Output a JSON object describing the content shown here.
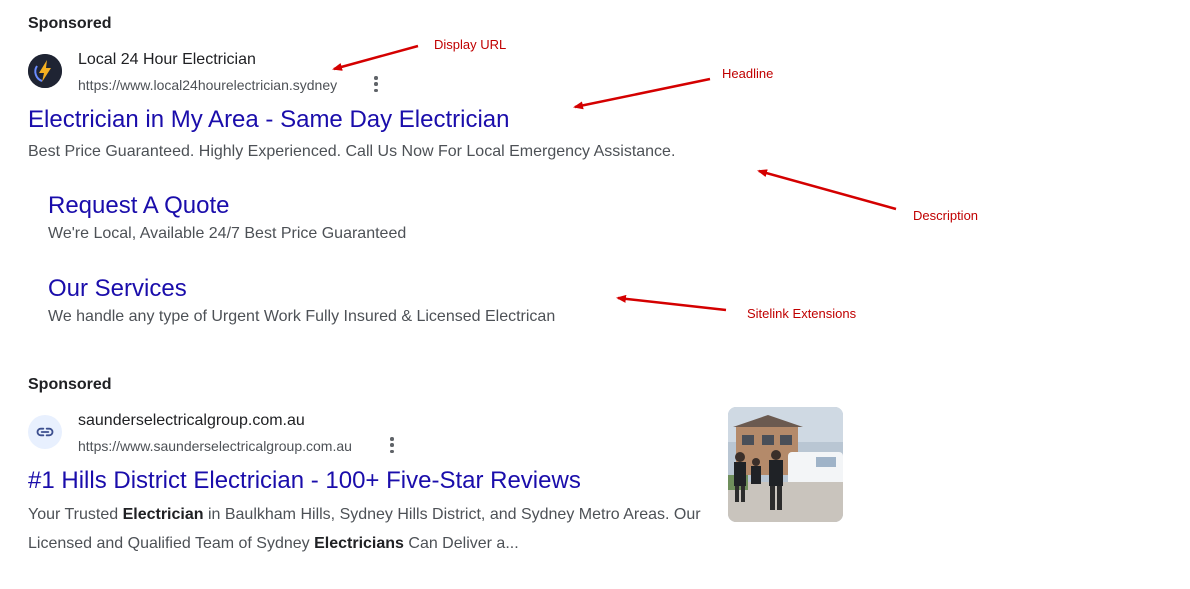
{
  "ad1": {
    "sponsored": "Sponsored",
    "site_name": "Local 24 Hour Electrician",
    "display_url": "https://www.local24hourelectrician.sydney",
    "favicon_icon": "lightning-bolt-icon",
    "headline": "Electrician in My Area - Same Day Electrician",
    "description": "Best Price Guaranteed. Highly Experienced. Call Us Now For Local Emergency Assistance.",
    "sitelinks": [
      {
        "title": "Request A Quote",
        "desc": "We're Local, Available 24/7 Best Price Guaranteed"
      },
      {
        "title": "Our Services",
        "desc": "We handle any type of Urgent Work Fully Insured & Licensed Electrican"
      }
    ]
  },
  "annotations": {
    "display_url": "Display URL",
    "headline": "Headline",
    "description": "Description",
    "sitelinks": "Sitelink Extensions",
    "color": "#d40000"
  },
  "ad2": {
    "sponsored": "Sponsored",
    "site_name": "saunderselectricalgroup.com.au",
    "display_url": "https://www.saunderselectricalgroup.com.au",
    "favicon_icon": "link-icon",
    "headline": "#1 Hills District Electrician - 100+ Five-Star Reviews",
    "desc_parts": {
      "p1": "Your Trusted ",
      "b1": "Electrician",
      "p2": " in Baulkham Hills, Sydney Hills District, and Sydney Metro Areas. Our Licensed and Qualified Team of Sydney ",
      "b2": "Electricians",
      "p3": " Can Deliver a..."
    },
    "thumbnail": "electricians-team-photo"
  },
  "colors": {
    "link": "#1a0dab",
    "text": "#202124",
    "muted": "#4d5156"
  }
}
